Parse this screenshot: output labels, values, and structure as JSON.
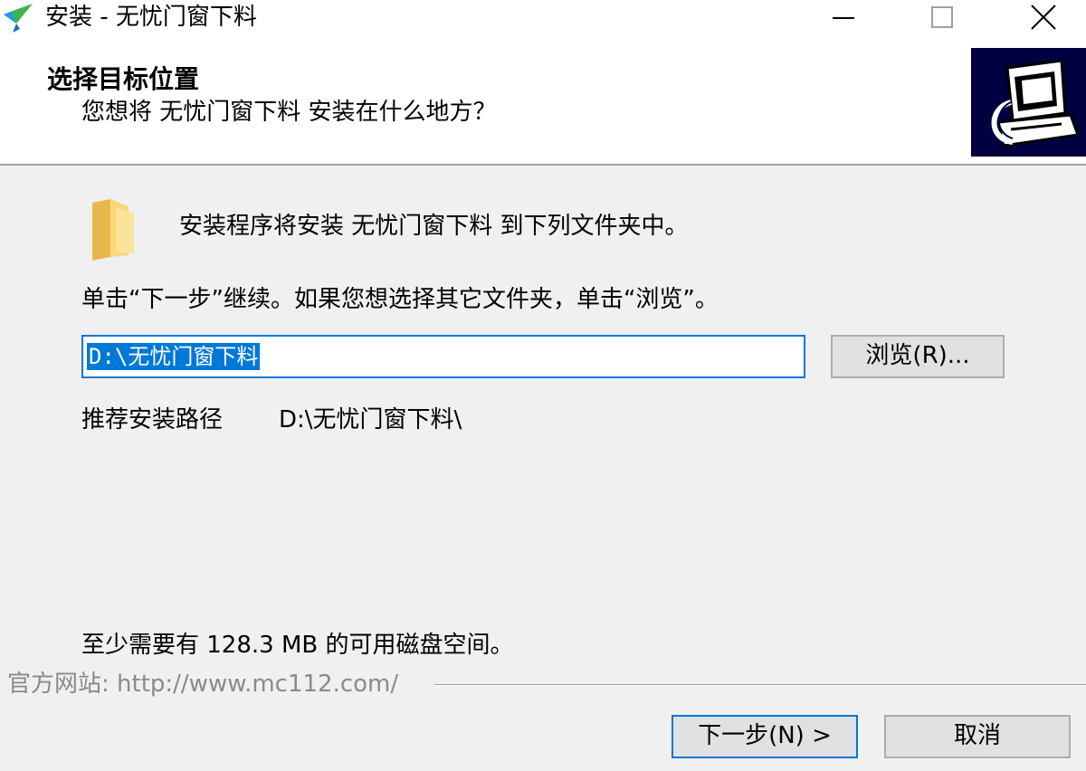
{
  "window": {
    "title": "安装 - 无忧门窗下料",
    "app_icon": "installer-arrow-icon",
    "controls": {
      "minimize": "minimize-icon",
      "maximize": "maximize-icon",
      "close": "close-icon"
    }
  },
  "header": {
    "title": "选择目标位置",
    "subtitle": "您想将 无忧门窗下料 安装在什么地方？",
    "image": "computer-install-icon"
  },
  "body": {
    "folder_icon": "folder-icon",
    "install_desc": "安装程序将安装 无忧门窗下料 到下列文件夹中。",
    "click_hint": "单击“下一步”继续。如果您想选择其它文件夹，单击“浏览”。",
    "path_input": {
      "value": "D:\\无忧门窗下料",
      "selected": true
    },
    "browse_label": "浏览(R)...",
    "recommend_label": "推荐安装路径",
    "recommend_path": "D:\\无忧门窗下料\\",
    "disk_space": "至少需要有 128.3 MB 的可用磁盘空间。"
  },
  "footer": {
    "website": "官方网站: http://www.mc112.com/",
    "next_label": "下一步(N) >",
    "cancel_label": "取消"
  },
  "colors": {
    "accent": "#0078d7",
    "background": "#f0f0f0",
    "header_bg": "#ffffff",
    "button_bg": "#e1e1e1",
    "muted_text": "#8a8a8a"
  }
}
